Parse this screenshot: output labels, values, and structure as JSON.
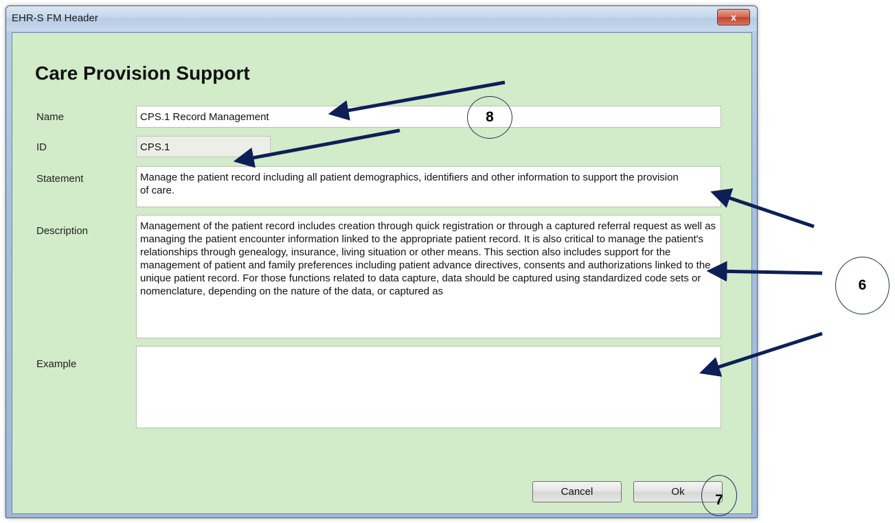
{
  "window": {
    "title": "EHR-S FM Header",
    "close_symbol": "x"
  },
  "form": {
    "heading": "Care Provision Support",
    "name_label": "Name",
    "name_value": "CPS.1 Record Management",
    "id_label": "ID",
    "id_value": "CPS.1",
    "statement_label": "Statement",
    "statement_value": "Manage the patient record including all patient demographics, identifiers and other information to support the provision of care.",
    "description_label": "Description",
    "description_value": "Management of the patient record includes creation through quick registration or through a captured referral request as well as managing the patient encounter information linked to the appropriate patient record.  It is also critical to manage the patient's relationships through genealogy, insurance, living situation or other means.  This section also includes support for the management of patient and family preferences including patient advance directives, consents and authorizations linked to the unique patient record. For those functions related to data capture, data should be captured using standardized code sets or nomenclature, depending on the nature of the data, or captured as",
    "example_label": "Example",
    "example_value": ""
  },
  "buttons": {
    "cancel": "Cancel",
    "ok": "Ok"
  },
  "callouts": {
    "name": "8",
    "description": "6",
    "ok": "7"
  },
  "colors": {
    "client_background": "#d2ebc8",
    "arrow": "#0d1f57"
  }
}
